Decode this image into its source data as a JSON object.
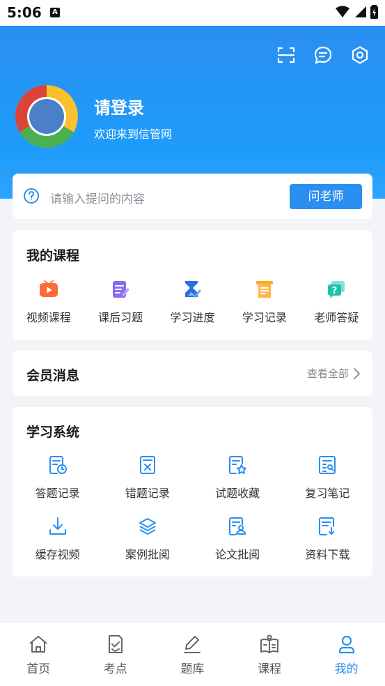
{
  "status_bar": {
    "time": "5:06",
    "a_icon": "A"
  },
  "header": {
    "login_title": "请登录",
    "login_subtitle": "欢迎来到信管网",
    "icons": [
      "scan-icon",
      "message-icon",
      "settings-icon"
    ]
  },
  "ask": {
    "placeholder": "请输入提问的内容",
    "button_label": "问老师"
  },
  "my_courses": {
    "title": "我的课程",
    "items": [
      {
        "label": "视频课程",
        "icon": "video-course-icon"
      },
      {
        "label": "课后习题",
        "icon": "exercise-icon"
      },
      {
        "label": "学习进度",
        "icon": "progress-icon"
      },
      {
        "label": "学习记录",
        "icon": "record-icon"
      },
      {
        "label": "老师答疑",
        "icon": "qa-icon"
      }
    ]
  },
  "member": {
    "title": "会员消息",
    "view_all": "查看全部"
  },
  "study_system": {
    "title": "学习系统",
    "items": [
      {
        "label": "答题记录",
        "icon": "answer-record-icon"
      },
      {
        "label": "错题记录",
        "icon": "wrong-record-icon"
      },
      {
        "label": "试题收藏",
        "icon": "favorite-icon"
      },
      {
        "label": "复习笔记",
        "icon": "notes-icon"
      },
      {
        "label": "缓存视频",
        "icon": "download-video-icon"
      },
      {
        "label": "案例批阅",
        "icon": "case-review-icon"
      },
      {
        "label": "论文批阅",
        "icon": "paper-review-icon"
      },
      {
        "label": "资料下载",
        "icon": "material-download-icon"
      }
    ]
  },
  "tabbar": {
    "items": [
      {
        "label": "首页",
        "icon": "home-icon"
      },
      {
        "label": "考点",
        "icon": "exam-point-icon"
      },
      {
        "label": "题库",
        "icon": "question-bank-icon"
      },
      {
        "label": "课程",
        "icon": "course-icon"
      },
      {
        "label": "我的",
        "icon": "profile-icon"
      }
    ],
    "active": "我的"
  },
  "colors": {
    "primary": "#2a8ff0",
    "background": "#f3f4f7"
  }
}
